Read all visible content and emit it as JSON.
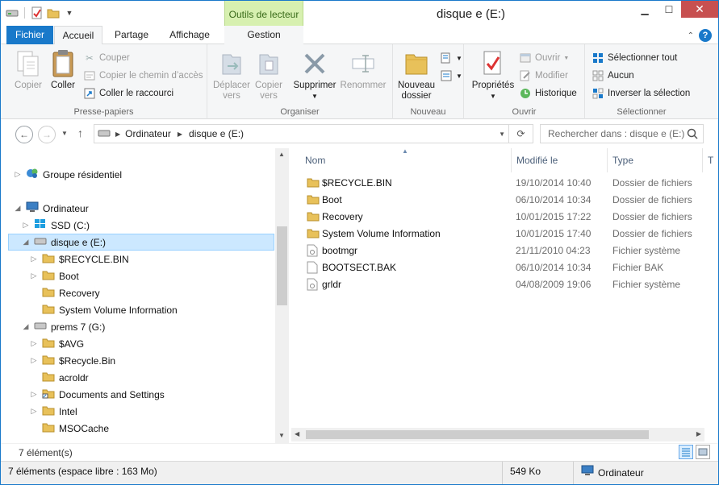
{
  "window": {
    "title": "disque e (E:)",
    "contextual_tab": "Outils de lecteur"
  },
  "tabs": [
    {
      "label": "Fichier"
    },
    {
      "label": "Accueil"
    },
    {
      "label": "Partage"
    },
    {
      "label": "Affichage"
    },
    {
      "label": "Gestion"
    }
  ],
  "ribbon": {
    "clipboard": {
      "copy": "Copier",
      "paste": "Coller",
      "cut": "Couper",
      "copy_path": "Copier le chemin d’accès",
      "paste_shortcut": "Coller le raccourci",
      "group": "Presse-papiers"
    },
    "organize": {
      "move_to": "Déplacer vers",
      "copy_to": "Copier vers",
      "delete": "Supprimer",
      "rename": "Renommer",
      "group": "Organiser"
    },
    "new": {
      "new_folder": "Nouveau dossier",
      "group": "Nouveau"
    },
    "open": {
      "properties": "Propriétés",
      "open": "Ouvrir",
      "edit": "Modifier",
      "history": "Historique",
      "group": "Ouvrir"
    },
    "select": {
      "select_all": "Sélectionner tout",
      "select_none": "Aucun",
      "invert": "Inverser la sélection",
      "group": "Sélectionner"
    }
  },
  "address": {
    "crumb1": "Ordinateur",
    "crumb2": "disque e (E:)",
    "search_placeholder": "Rechercher dans : disque e (E:)"
  },
  "nav": {
    "homegroup": "Groupe résidentiel",
    "computer": "Ordinateur",
    "ssd": "SSD (C:)",
    "drive_e": "disque e (E:)",
    "e_children": [
      "$RECYCLE.BIN",
      "Boot",
      "Recovery",
      "System Volume Information"
    ],
    "drive_g": "prems 7 (G:)",
    "g_children": [
      "$AVG",
      "$Recycle.Bin",
      "acroldr",
      "Documents and Settings",
      "Intel",
      "MSOCache"
    ]
  },
  "columns": {
    "name": "Nom",
    "modified": "Modifié le",
    "type": "Type",
    "extra": "T"
  },
  "files": [
    {
      "name": "$RECYCLE.BIN",
      "date": "19/10/2014 10:40",
      "type": "Dossier de fichiers",
      "kind": "folder"
    },
    {
      "name": "Boot",
      "date": "06/10/2014 10:34",
      "type": "Dossier de fichiers",
      "kind": "folder"
    },
    {
      "name": "Recovery",
      "date": "10/01/2015 17:22",
      "type": "Dossier de fichiers",
      "kind": "folder"
    },
    {
      "name": "System Volume Information",
      "date": "10/01/2015 17:40",
      "type": "Dossier de fichiers",
      "kind": "folder"
    },
    {
      "name": "bootmgr",
      "date": "21/11/2010 04:23",
      "type": "Fichier système",
      "kind": "sysfile"
    },
    {
      "name": "BOOTSECT.BAK",
      "date": "06/10/2014 10:34",
      "type": "Fichier BAK",
      "kind": "file"
    },
    {
      "name": "grldr",
      "date": "04/08/2009 19:06",
      "type": "Fichier système",
      "kind": "sysfile"
    }
  ],
  "status": {
    "item_count": "7 élément(s)",
    "summary": "7 éléments (espace libre : 163 Mo)",
    "size": "549 Ko",
    "location": "Ordinateur"
  },
  "colors": {
    "accent": "#1979ca",
    "selection": "#cce8ff",
    "folder": "#e8c15a",
    "contextual": "#d7f0b0"
  }
}
